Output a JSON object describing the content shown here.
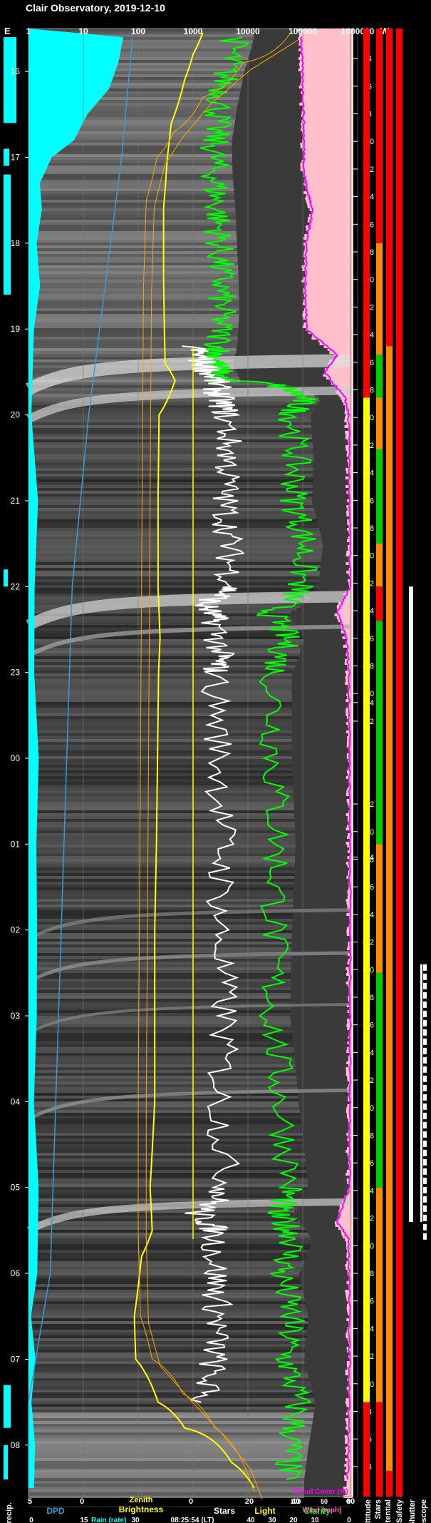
{
  "title": "Clair Observatory, 2019-12-10",
  "top_labels": {
    "east": "E",
    "west": "W"
  },
  "top_scale": [
    "1",
    "10",
    "100",
    "1000",
    "10000",
    "100000",
    "1000000"
  ],
  "hour_labels": [
    "16",
    "17",
    "18",
    "19",
    "20",
    "21",
    "22",
    "23",
    "00",
    "01",
    "02",
    "03",
    "04",
    "05",
    "06",
    "07",
    "08"
  ],
  "alt_labels": [
    "-4",
    "-6",
    "-8",
    "-10",
    "-12",
    "-14",
    "-16",
    "-18",
    "-20",
    "-22",
    "-24",
    "-26",
    "-28",
    "-30",
    "-32",
    "-34",
    "-36",
    "-38",
    "-40",
    "-42",
    "-44",
    "-46",
    "-48",
    "-50",
    "-52",
    "-54",
    "-54",
    "-52",
    "-50",
    "-48",
    "-46",
    "-44",
    "-42",
    "-40",
    "-38",
    "-36",
    "-34",
    "-32",
    "-30",
    "-28",
    "-26",
    "-24",
    "-22",
    "-20",
    "-18",
    "-16",
    "-14",
    "-12",
    "-10",
    "-8",
    "-6",
    "-4"
  ],
  "bottom": {
    "row1": {
      "dpd_ticks": [
        "5",
        "0"
      ],
      "dpd": "DPD",
      "zenith1": "Zenith",
      "zenith2": "Brightness",
      "stars_ticks": [
        "0",
        "20"
      ],
      "stars": "Stars",
      "light": "Light",
      "clarity_ticks": [
        "40",
        "60"
      ],
      "clarity": "Clarity"
    },
    "row2": {
      "rain_ticks": [
        "0",
        "15",
        "30"
      ],
      "rain": "Rain (rate)",
      "time": "08:25:54 (LT)",
      "wind_ticks": [
        "40",
        "30",
        "20",
        "10",
        "0"
      ],
      "wind": "Wind (mph)"
    },
    "row3": {
      "cc_ticks": [
        "100",
        "50",
        "0"
      ],
      "cloud": "Cloud Cover (%)"
    },
    "forecast": "Forecast Precip.",
    "strips": [
      "Sun Altitude",
      "Stars",
      "Obs. Potential",
      "Shutter Safety",
      "Shutter",
      "Telescope"
    ]
  },
  "colors": {
    "rain": "#00ffff",
    "dpd": "#3a9ad9",
    "zenith": "#ffff00",
    "zenith_model": "#ffa500",
    "stars": "#ffffff",
    "clarity": "#00ff00",
    "cloud": "#ff00ff",
    "pink": "#ffc0cb",
    "red": "#ff0000",
    "orange": "#ff8c00",
    "green": "#00cc00",
    "yellow": "#ffff00"
  },
  "chart_data": {
    "type": "line",
    "title": "Clair Observatory, 2019-12-10",
    "time_axis": {
      "start": 15.5,
      "end": 32.6,
      "labels": [
        "16",
        "17",
        "18",
        "19",
        "20",
        "21",
        "22",
        "23",
        "00",
        "01",
        "02",
        "03",
        "04",
        "05",
        "06",
        "07",
        "08"
      ]
    },
    "top_axis": {
      "scale": "log",
      "range": [
        1,
        1000000
      ]
    },
    "series": [
      {
        "key": "clarity",
        "name": "Clarity",
        "t": [
          15.6,
          16.0,
          16.4,
          16.8,
          17.2,
          17.6,
          18.0,
          18.4,
          18.8,
          19.2,
          19.4,
          19.6,
          19.8,
          20.0,
          20.5,
          21.0,
          21.5,
          22.0,
          22.3,
          22.6,
          23.0,
          24.0,
          25.0,
          26.0,
          27.0,
          28.0,
          29.0,
          29.3,
          29.6,
          30.0,
          30.5,
          31.0,
          31.5,
          32.0,
          32.4
        ],
        "v": [
          6000,
          4000,
          3000,
          2400,
          2500,
          2800,
          3000,
          3200,
          3300,
          3000,
          2500,
          3500,
          100000,
          65000,
          75000,
          70000,
          110000,
          90000,
          25000,
          50000,
          30000,
          30000,
          35000,
          30000,
          28000,
          40000,
          60000,
          30000,
          70000,
          40000,
          60000,
          50000,
          80000,
          60000,
          50000
        ]
      },
      {
        "key": "stars",
        "name": "Stars",
        "t": [
          19.2,
          19.4,
          19.6,
          19.8,
          20.0,
          20.5,
          21.0,
          21.5,
          22.0,
          22.2,
          22.4,
          22.8,
          23.0,
          24.0,
          25.0,
          26.0,
          27.0,
          28.0,
          29.0,
          29.3,
          29.5,
          30.0,
          30.5,
          31.0,
          31.5
        ],
        "v": [
          1000,
          1500,
          2500,
          3000,
          4000,
          4500,
          3800,
          4500,
          5000,
          1500,
          2600,
          3000,
          2500,
          3000,
          3500,
          3000,
          3800,
          3000,
          4000,
          1200,
          2500,
          2600,
          2800,
          2400,
          1400
        ]
      },
      {
        "key": "zenith",
        "name": "Zenith Brightness",
        "t": [
          15.55,
          15.8,
          16.1,
          16.4,
          16.6,
          17.0,
          17.6,
          18.4,
          19.0,
          19.4,
          19.6,
          20.0,
          21.0,
          22.0,
          22.6,
          23.0,
          24.0,
          25.0,
          26.0,
          27.0,
          28.0,
          29.0,
          29.5,
          29.8,
          30.5,
          31.0,
          31.5,
          31.8,
          32.2,
          32.5
        ],
        "v": [
          1500,
          1000,
          700,
          520,
          400,
          340,
          290,
          290,
          300,
          310,
          470,
          240,
          230,
          230,
          250,
          235,
          225,
          215,
          200,
          200,
          200,
          165,
          180,
          115,
          85,
          90,
          230,
          700,
          5000,
          13000
        ]
      },
      {
        "key": "zenith_model",
        "name": "Zenith model",
        "t": [
          15.55,
          15.9,
          16.3,
          16.7,
          17.0,
          17.5,
          18.5,
          20.0,
          22.0,
          24.0,
          26.0,
          28.0,
          29.5,
          30.5,
          31.0,
          31.4,
          31.8,
          32.2,
          32.55
        ],
        "v": [
          60000,
          8000,
          1500,
          450,
          220,
          140,
          125,
          120,
          115,
          110,
          105,
          100,
          100,
          110,
          180,
          650,
          2500,
          8000,
          13000
        ]
      },
      {
        "key": "cloud",
        "name": "Cloud Cover (%)",
        "t": [
          15.6,
          16.0,
          16.4,
          16.8,
          17.2,
          17.4,
          17.6,
          17.8,
          18.0,
          18.5,
          19.0,
          19.3,
          19.5,
          19.8,
          20.0,
          21.0,
          22.0,
          22.3,
          22.6,
          23.0,
          24.0,
          25.0,
          26.0,
          27.0,
          28.0,
          29.0,
          29.4,
          29.6,
          30.0,
          31.0,
          32.0,
          32.4
        ],
        "v": [
          100,
          98,
          96,
          95,
          94,
          88,
          78,
          84,
          90,
          92,
          90,
          30,
          55,
          15,
          8,
          6,
          5,
          30,
          12,
          7,
          6,
          5,
          5,
          5,
          5,
          6,
          30,
          8,
          7,
          6,
          8,
          10
        ]
      }
    ],
    "rain_profile": {
      "t": [
        15.6,
        15.9,
        16.2,
        16.5,
        16.8,
        17.0,
        17.3,
        17.6,
        18.0,
        18.5,
        19.0,
        20.0,
        21.0,
        22.0,
        23.0,
        24.0,
        25.0,
        26.0,
        27.0,
        28.0,
        29.0,
        30.0,
        30.5,
        31.0,
        31.5,
        32.0,
        32.5
      ],
      "v": [
        30,
        28,
        24,
        18,
        12,
        7,
        3,
        2,
        1.5,
        1,
        1,
        0.8,
        0.8,
        0.8,
        0.8,
        0.8,
        0.8,
        0.8,
        0.8,
        0.8,
        0.8,
        0.8,
        0.8,
        0.8,
        0.8,
        0.8,
        0.8
      ]
    },
    "dpd": {
      "t": [
        15.6,
        17.0,
        18.0,
        20.0,
        22.0,
        24.0,
        26.0,
        28.0,
        30.0,
        31.5,
        32.5
      ],
      "v": [
        3.8,
        3.6,
        3.4,
        3.0,
        2.7,
        2.6,
        2.5,
        2.4,
        2.3,
        1.8,
        1.6
      ]
    },
    "status_strips": {
      "sun_altitude": [
        [
          15.5,
          32.6,
          "red"
        ]
      ],
      "stars": [
        [
          15.5,
          19.8,
          "red"
        ],
        [
          19.8,
          31.5,
          "yellow"
        ],
        [
          31.5,
          32.6,
          "red"
        ]
      ],
      "obs_potential": [
        [
          15.5,
          18.0,
          "red"
        ],
        [
          18.0,
          19.3,
          "orange"
        ],
        [
          19.3,
          19.8,
          "green"
        ],
        [
          19.8,
          20.4,
          "orange"
        ],
        [
          20.4,
          21.5,
          "green"
        ],
        [
          21.5,
          22.0,
          "orange"
        ],
        [
          22.0,
          22.4,
          "red"
        ],
        [
          22.4,
          25.0,
          "green"
        ],
        [
          25.0,
          26.5,
          "orange"
        ],
        [
          26.5,
          29.0,
          "green"
        ],
        [
          29.0,
          31.5,
          "orange"
        ],
        [
          31.5,
          32.6,
          "red"
        ]
      ],
      "shutter_safety": [
        [
          15.5,
          19.2,
          "red"
        ],
        [
          19.2,
          32.3,
          "orange"
        ],
        [
          32.3,
          32.6,
          "red"
        ]
      ],
      "shutter": [
        [
          22.0,
          29.4,
          "white"
        ]
      ],
      "telescope": [
        [
          26.4,
          29.4,
          "white"
        ]
      ]
    }
  }
}
